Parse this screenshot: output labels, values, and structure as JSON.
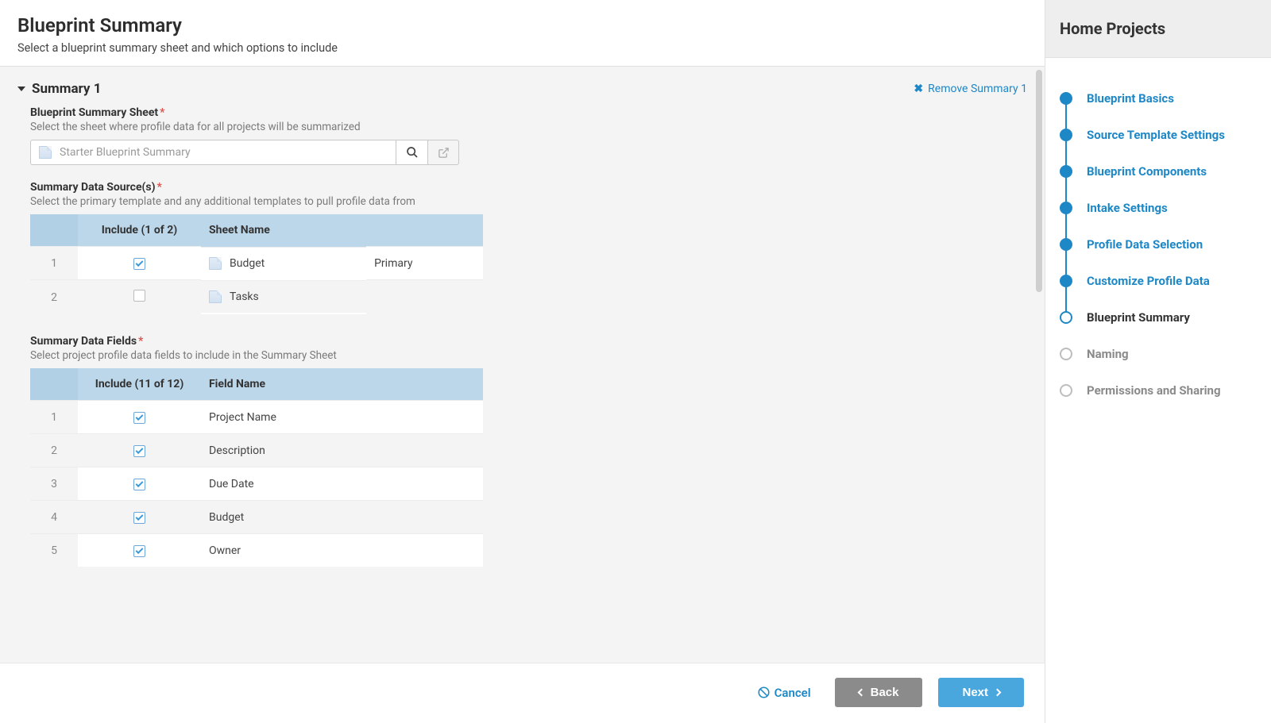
{
  "header": {
    "title": "Blueprint Summary",
    "subtitle": "Select a blueprint summary sheet and which options to include"
  },
  "section": {
    "title": "Summary 1",
    "remove_label": "Remove Summary 1"
  },
  "sheet_picker": {
    "label": "Blueprint Summary Sheet",
    "desc": "Select the sheet where profile data for all projects will be summarized",
    "placeholder": "Starter Blueprint Summary"
  },
  "sources": {
    "label": "Summary Data Source(s)",
    "desc": "Select the primary template and any additional templates to pull profile data from",
    "include_header": "Include (1 of 2)",
    "sheet_header": "Sheet Name",
    "rows": [
      {
        "idx": "1",
        "checked": true,
        "name": "Budget",
        "note": "Primary"
      },
      {
        "idx": "2",
        "checked": false,
        "name": "Tasks",
        "note": ""
      }
    ]
  },
  "fields": {
    "label": "Summary Data Fields",
    "desc": "Select project profile data fields to include in the Summary Sheet",
    "include_header": "Include (11 of 12)",
    "field_header": "Field Name",
    "rows": [
      {
        "idx": "1",
        "checked": true,
        "name": "Project Name"
      },
      {
        "idx": "2",
        "checked": true,
        "name": "Description"
      },
      {
        "idx": "3",
        "checked": true,
        "name": "Due Date"
      },
      {
        "idx": "4",
        "checked": true,
        "name": "Budget"
      },
      {
        "idx": "5",
        "checked": true,
        "name": "Owner"
      }
    ]
  },
  "footer": {
    "cancel": "Cancel",
    "back": "Back",
    "next": "Next"
  },
  "sidebar": {
    "title": "Home Projects",
    "steps": [
      {
        "label": "Blueprint Basics",
        "state": "done"
      },
      {
        "label": "Source Template Settings",
        "state": "done"
      },
      {
        "label": "Blueprint Components",
        "state": "done"
      },
      {
        "label": "Intake Settings",
        "state": "done"
      },
      {
        "label": "Profile Data Selection",
        "state": "done"
      },
      {
        "label": "Customize Profile Data",
        "state": "done"
      },
      {
        "label": "Blueprint Summary",
        "state": "current"
      },
      {
        "label": "Naming",
        "state": "pending"
      },
      {
        "label": "Permissions and Sharing",
        "state": "pending"
      }
    ]
  }
}
